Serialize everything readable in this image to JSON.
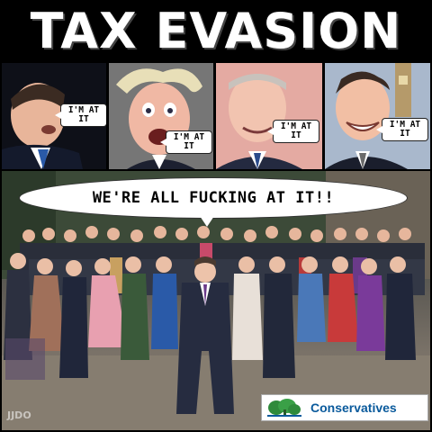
{
  "banner": {
    "title": "TAX EVASION"
  },
  "portraits": [
    {
      "caption": "I'M AT\nIT"
    },
    {
      "caption": "I'M AT\nIT"
    },
    {
      "caption": "I'M AT\nIT"
    },
    {
      "caption": "I'M AT\nIT"
    }
  ],
  "group_photo": {
    "speech": "WE'RE ALL FUCKING AT IT!!",
    "logo_text": "Conservatives",
    "watermark": "JJDO"
  },
  "colors": {
    "background": "#000000",
    "banner_text": "#ffffff",
    "logo_blue": "#0a5a9c",
    "logo_green": "#2f8a3b"
  }
}
